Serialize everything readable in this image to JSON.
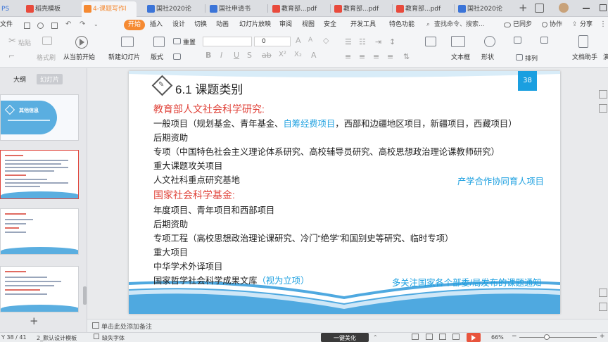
{
  "tabs": [
    {
      "label": "PS",
      "color": "#3b74d8"
    },
    {
      "label": "稻壳模板",
      "color": "#e84a3c"
    },
    {
      "label": "4-课题写作l",
      "color": "#f58a32"
    },
    {
      "label": "国社2020论",
      "color": "#3b74d8"
    },
    {
      "label": "国社申请书",
      "color": "#3b74d8"
    },
    {
      "label": "教育部...pdf",
      "color": "#e84a3c"
    },
    {
      "label": "教育部...pdf",
      "color": "#e84a3c"
    },
    {
      "label": "教育部...pdf",
      "color": "#e84a3c"
    },
    {
      "label": "国社2020论",
      "color": "#3b74d8"
    }
  ],
  "menus": [
    "文件",
    "开始",
    "插入",
    "设计",
    "切换",
    "动画",
    "幻灯片放映",
    "审阅",
    "视图",
    "安全",
    "开发工具",
    "特色功能",
    "查找命令、搜索..."
  ],
  "menu_right": {
    "sync": "已同步",
    "collab": "协作",
    "share": "分享"
  },
  "ribbon": {
    "paste": "粘贴",
    "format_painter": "格式刷",
    "from_current": "从当前开始",
    "new_slide": "新建幻灯片",
    "layout": "版式",
    "reset": "重置",
    "font_size": "0",
    "textbox": "文本框",
    "shapes": "形状",
    "arrange": "排列",
    "doc_assistant": "文档助手",
    "more": "演"
  },
  "left_panel": {
    "outline_tab": "大纲",
    "slides_tab": "幻灯片",
    "thumb1_title": "其他信息"
  },
  "slide": {
    "number": "38",
    "title": "6.1 课题类别",
    "lines": [
      {
        "text": "教育部人文社会科学研究:"
      },
      {
        "pre": "一般项目（规划基金、青年基金、",
        "highlight": "自筹经费项目",
        "post": "，西部和边疆地区项目，新疆项目，西藏项目）"
      },
      {
        "text": "后期资助"
      },
      {
        "text": "专项（中国特色社会主义理论体系研究、高校辅导员研究、高校思想政治理论课教师研究）"
      },
      {
        "text": "重大课题攻关项目"
      },
      {
        "text": "人文社科重点研究基地"
      },
      {
        "text": "国家社会科学基金:"
      },
      {
        "text": "年度项目、青年项目和西部项目"
      },
      {
        "text": "后期资助"
      },
      {
        "text": "专项工程（高校思想政治理论课研究、冷门“绝学”和国别史等研究、临时专项）"
      },
      {
        "text": "重大项目"
      },
      {
        "text": "中华学术外译项目"
      },
      {
        "pre": "国家哲学社会科学成果文库",
        "highlight": "（视为立项）"
      }
    ],
    "note_right_1": "产学合作协同育人项目",
    "note_right_2": "多关注国家各个部委/局发布的课题通知"
  },
  "notes_placeholder": "单击此处添加备注",
  "status": {
    "slide_count": "Y 38 / 41",
    "theme": "2_默认设计模板",
    "missing_font": "缺失字体",
    "beautify": "一键美化",
    "zoom": "66%"
  },
  "colors": {
    "accent": "#f58a32",
    "title_red": "#e0443b",
    "highlight_blue": "#1a9fe0",
    "slide_number_bg": "#1a9fe0"
  }
}
